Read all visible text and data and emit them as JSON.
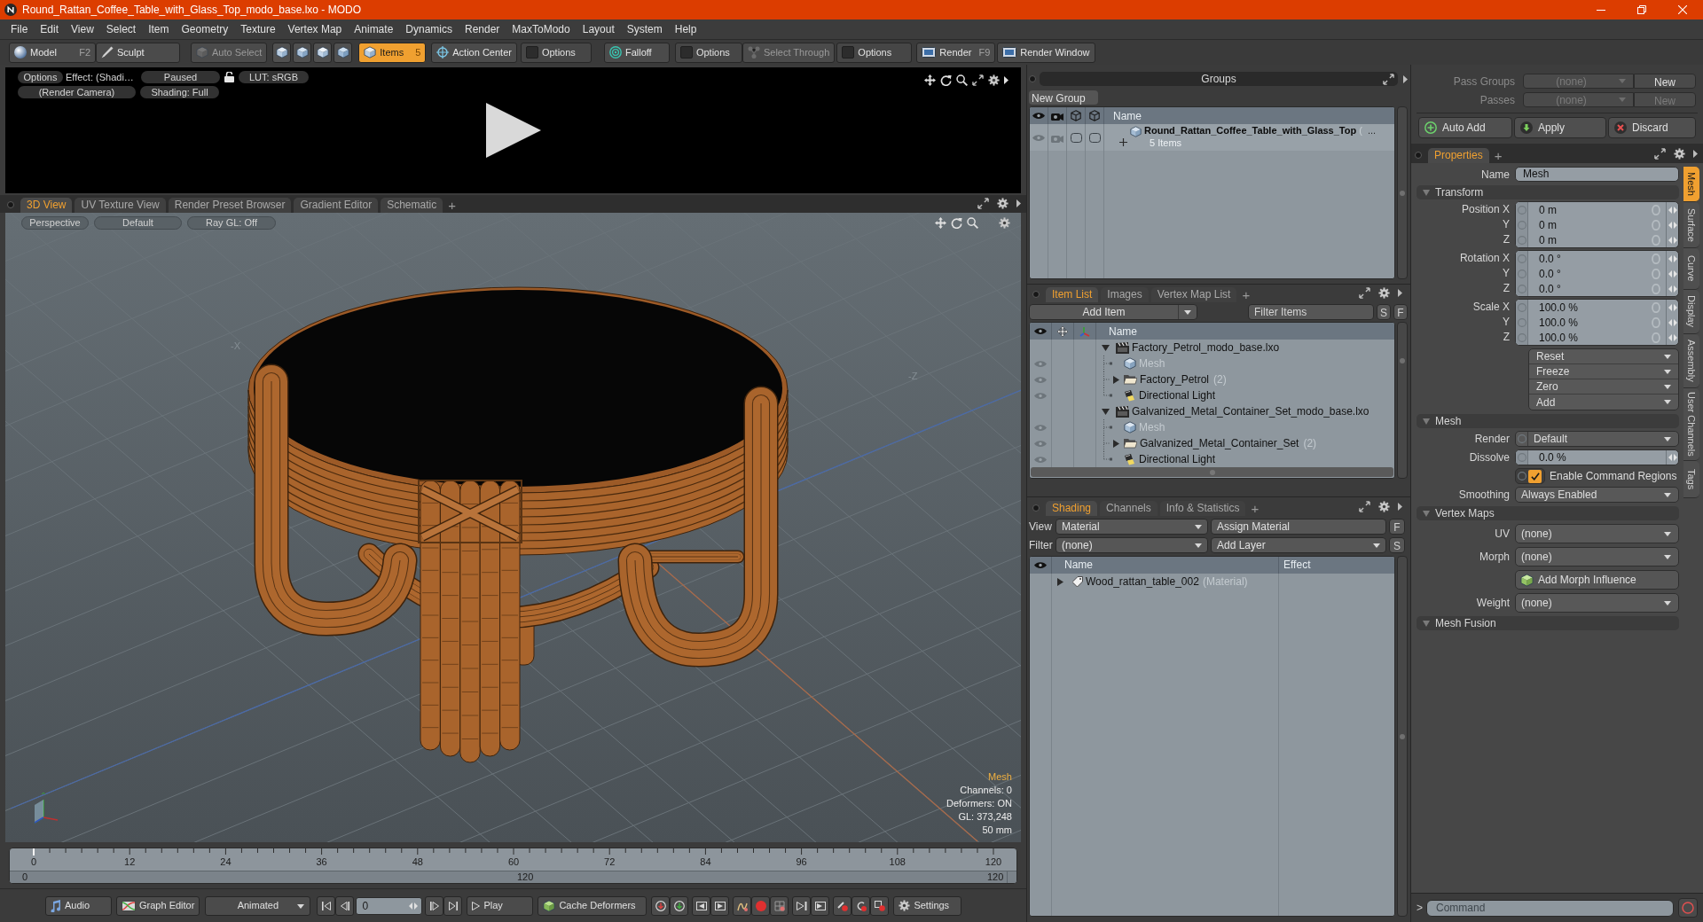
{
  "window": {
    "title": "Round_Rattan_Coffee_Table_with_Glass_Top_modo_base.lxo - MODO"
  },
  "menu": [
    "File",
    "Edit",
    "View",
    "Select",
    "Item",
    "Geometry",
    "Texture",
    "Vertex Map",
    "Animate",
    "Dynamics",
    "Render",
    "MaxToModo",
    "Layout",
    "System",
    "Help"
  ],
  "toolbar": [
    {
      "kind": "mode",
      "label": "Model",
      "shortcut": "F2",
      "selected": false,
      "disabled": false
    },
    {
      "kind": "mode",
      "label": "Sculpt",
      "selected": false,
      "disabled": false
    },
    {
      "kind": "button",
      "label": "Auto Select",
      "selected": false,
      "disabled": true
    },
    {
      "kind": "component_icons"
    },
    {
      "kind": "button",
      "label": "Items",
      "badge": "5",
      "selected": true,
      "disabled": false
    },
    {
      "kind": "button",
      "label": "Action Center",
      "selected": false,
      "disabled": false
    },
    {
      "kind": "check",
      "label": "Options",
      "checked": false
    },
    {
      "kind": "button",
      "label": "Falloff",
      "selected": false,
      "disabled": false
    },
    {
      "kind": "check",
      "label": "Options",
      "checked": false
    },
    {
      "kind": "button",
      "label": "Select Through",
      "selected": false,
      "disabled": true
    },
    {
      "kind": "check",
      "label": "Options",
      "checked": false
    },
    {
      "kind": "button",
      "label": "Render",
      "shortcut": "F9",
      "selected": false,
      "disabled": false
    },
    {
      "kind": "button",
      "label": "Render Window",
      "selected": false,
      "disabled": false
    }
  ],
  "render_preview": {
    "options": "Options",
    "effect": "Effect: (Shadi…",
    "state": "Paused",
    "lut": "LUT: sRGB",
    "camera": "(Render Camera)",
    "shading": "Shading: Full"
  },
  "viewport_tabs": {
    "tabs": [
      {
        "label": "3D View",
        "selected": true
      },
      {
        "label": "UV Texture View",
        "selected": false
      },
      {
        "label": "Render Preset Browser",
        "selected": false
      },
      {
        "label": "Gradient Editor",
        "selected": false
      },
      {
        "label": "Schematic",
        "selected": false
      }
    ],
    "add": "+"
  },
  "viewport": {
    "view": "Perspective",
    "style": "Default",
    "ray_gl": "Ray GL: Off",
    "axis_labels": [
      "-X",
      "-Z"
    ],
    "selection": "Mesh",
    "info": [
      "Channels: 0",
      "Deformers: ON",
      "GL: 373,248",
      "50 mm"
    ]
  },
  "timeline": {
    "ticks": [
      "0",
      "12",
      "24",
      "36",
      "48",
      "60",
      "72",
      "84",
      "96",
      "108",
      "120"
    ],
    "range": [
      "0",
      "120",
      "120"
    ]
  },
  "transport": {
    "audio": "Audio",
    "graph_editor": "Graph Editor",
    "key_mode": "Animated",
    "frame": "0",
    "play": "Play",
    "cache": "Cache Deformers",
    "settings": "Settings"
  },
  "groups": {
    "title": "Groups",
    "new_group": "New Group",
    "column": "Name",
    "rows": [
      {
        "name": "Round_Rattan_Coffee_Table_with_Glass_Top",
        "suffix": "(",
        "more": "...",
        "subtitle": "5 Items",
        "expanded": false
      }
    ]
  },
  "item_list": {
    "tabs": [
      {
        "label": "Item List",
        "selected": true
      },
      {
        "label": "Images",
        "selected": false
      },
      {
        "label": "Vertex Map List",
        "selected": false
      }
    ],
    "add": "+",
    "add_item": "Add Item",
    "filter": {
      "placeholder": "Filter Items"
    },
    "buttons": [
      "S",
      "F"
    ],
    "column": "Name",
    "items": [
      {
        "kind": "scene",
        "name": "Factory_Petrol_modo_base.lxo",
        "expanded": true,
        "children": [
          {
            "kind": "mesh",
            "name": "Mesh",
            "disabled": true
          },
          {
            "kind": "folder",
            "name": "Factory_Petrol",
            "count": "(2)",
            "expanded": false,
            "disabled": false
          },
          {
            "kind": "light",
            "name": "Directional Light",
            "disabled": false
          }
        ]
      },
      {
        "kind": "scene",
        "name": "Galvanized_Metal_Container_Set_modo_base.lxo",
        "expanded": true,
        "children": [
          {
            "kind": "mesh",
            "name": "Mesh",
            "disabled": true
          },
          {
            "kind": "folder",
            "name": "Galvanized_Metal_Container_Set",
            "count": "(2)",
            "expanded": false,
            "disabled": false
          },
          {
            "kind": "light",
            "name": "Directional Light",
            "disabled": false
          }
        ]
      }
    ]
  },
  "shading": {
    "tabs": [
      {
        "label": "Shading",
        "selected": true
      },
      {
        "label": "Channels",
        "selected": false
      },
      {
        "label": "Info & Statistics",
        "selected": false
      }
    ],
    "add": "+",
    "view_label": "View",
    "view_value": "Material",
    "assign": "Assign Material",
    "assign_key": "F",
    "filter_label": "Filter",
    "filter_value": "(none)",
    "add_layer": "Add Layer",
    "add_layer_key": "S",
    "columns": [
      "Name",
      "Effect"
    ],
    "rows": [
      {
        "name": "Wood_rattan_table_002",
        "type": "(Material)",
        "expanded": false
      }
    ]
  },
  "passes": {
    "rows": [
      {
        "label": "Pass Groups",
        "value": "(none)",
        "button": "New",
        "disabled": false
      },
      {
        "label": "Passes",
        "value": "(none)",
        "button": "New",
        "disabled": true
      }
    ],
    "actions": [
      "Auto Add",
      "Apply",
      "Discard"
    ]
  },
  "properties": {
    "tabs": [
      {
        "label": "Properties",
        "selected": true
      }
    ],
    "add": "+",
    "name_label": "Name",
    "name_value": "Mesh",
    "sections": [
      {
        "title": "Transform",
        "expanded": true,
        "rows": [
          {
            "kind": "vector",
            "labels": [
              "Position X",
              "Y",
              "Z"
            ],
            "values": [
              "0 m",
              "0 m",
              "0 m"
            ]
          },
          {
            "kind": "vector",
            "labels": [
              "Rotation X",
              "Y",
              "Z"
            ],
            "values": [
              "0.0 °",
              "0.0 °",
              "0.0 °"
            ]
          },
          {
            "kind": "vector",
            "labels": [
              "Scale X",
              "Y",
              "Z"
            ],
            "values": [
              "100.0 %",
              "100.0 %",
              "100.0 %"
            ]
          },
          {
            "kind": "menu_stack",
            "items": [
              "Reset",
              "Freeze",
              "Zero",
              "Add"
            ]
          }
        ]
      },
      {
        "title": "Mesh",
        "expanded": true,
        "rows": [
          {
            "kind": "channel_dropdown",
            "label": "Render",
            "value": "Default"
          },
          {
            "kind": "number",
            "label": "Dissolve",
            "value": "0.0 %"
          },
          {
            "kind": "checkbox",
            "label": "Enable Command Regions",
            "checked": true
          },
          {
            "kind": "dropdown",
            "label": "Smoothing",
            "value": "Always Enabled"
          }
        ]
      },
      {
        "title": "Vertex Maps",
        "expanded": true,
        "rows": [
          {
            "kind": "map_dropdown",
            "label": "UV",
            "value": "(none)"
          },
          {
            "kind": "map_dropdown",
            "label": "Morph",
            "value": "(none)"
          },
          {
            "kind": "action",
            "label": "Add Morph Influence"
          },
          {
            "kind": "map_dropdown",
            "label": "Weight",
            "value": "(none)"
          }
        ]
      },
      {
        "title": "Mesh Fusion",
        "expanded": true
      }
    ],
    "side_tabs": [
      {
        "label": "Mesh",
        "selected": true
      },
      {
        "label": "Surface",
        "selected": false
      },
      {
        "label": "Curve",
        "selected": false
      },
      {
        "label": "Display",
        "selected": false
      },
      {
        "label": "Assembly",
        "selected": false
      },
      {
        "label": "User Channels",
        "selected": false
      },
      {
        "label": "Tags",
        "selected": false
      }
    ]
  },
  "command": {
    "prompt": ">",
    "placeholder": "Command"
  }
}
